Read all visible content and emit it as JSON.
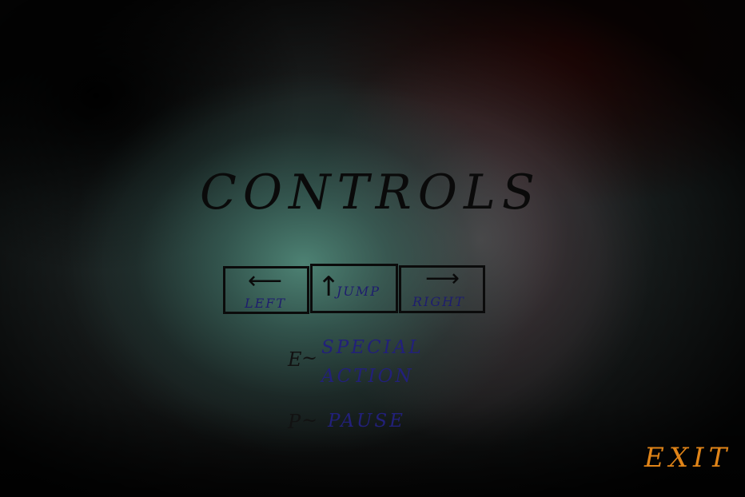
{
  "screen": {
    "title": "CONTROLS"
  },
  "keys": {
    "left": {
      "label": "LEFT",
      "arrow": "⟵"
    },
    "jump": {
      "label": "JUMP",
      "arrow": "↑"
    },
    "right": {
      "label": "RIGHT",
      "arrow": "⟶"
    }
  },
  "actions": {
    "special": {
      "key": "E",
      "separator": "~",
      "label_line1": "SPECIAL",
      "label_line2": "ACTION"
    },
    "pause": {
      "key": "P",
      "separator": "~",
      "label": "PAUSE"
    }
  },
  "exit_label": "EXIT",
  "colors": {
    "title": "#0a0a0a",
    "key_border": "#0b0b0b",
    "key_label": "#1e1d6e",
    "action_label": "#22207a",
    "exit": "#e08418"
  }
}
